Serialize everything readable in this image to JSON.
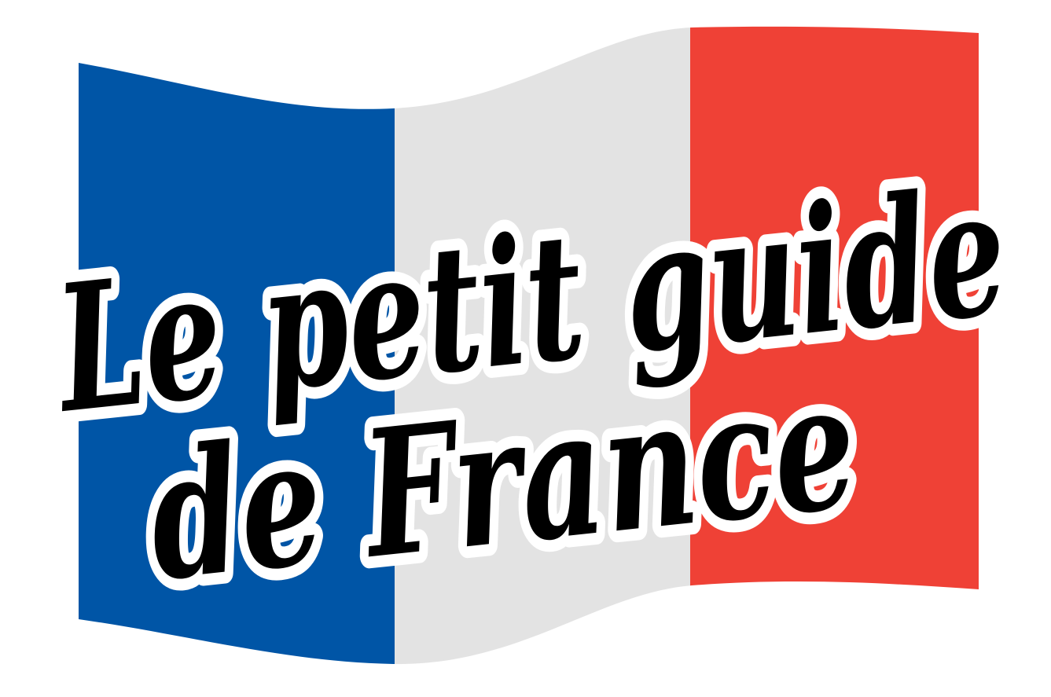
{
  "logo": {
    "title_line1": "Le petit guide",
    "title_line2": "de France"
  },
  "flag": {
    "blue": "#0055A6",
    "white": "#E3E3E3",
    "red": "#EF4136"
  },
  "colors": {
    "text": "#000000",
    "outline": "#FFFFFF",
    "background": "#FFFFFF"
  }
}
